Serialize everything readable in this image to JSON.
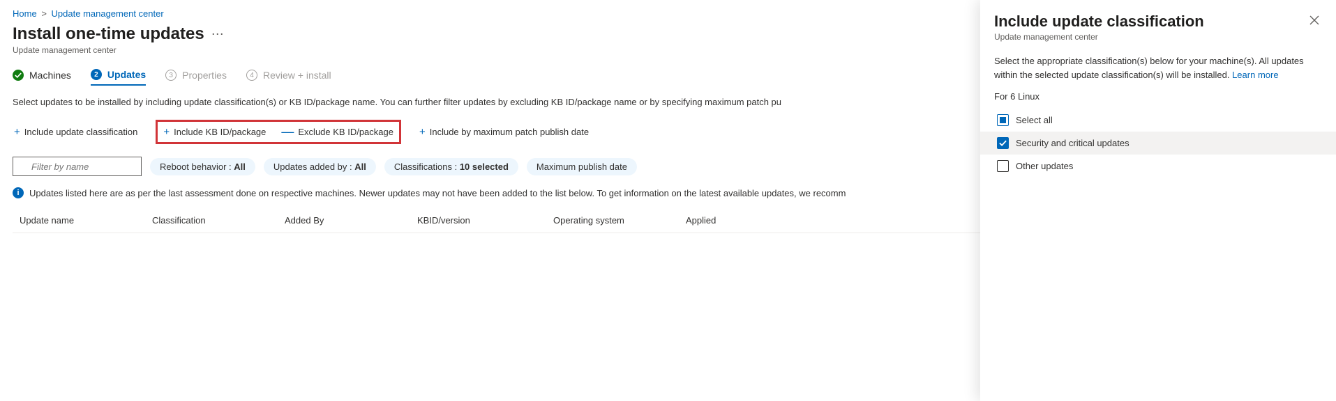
{
  "breadcrumb": {
    "home": "Home",
    "second": "Update management center"
  },
  "page": {
    "title": "Install one-time updates",
    "subtitle": "Update management center"
  },
  "tabs": {
    "t1": "Machines",
    "t2": "Updates",
    "t3": "Properties",
    "t4": "Review + install",
    "n3": "3",
    "n4": "4",
    "n2": "2"
  },
  "description": "Select updates to be installed by including update classification(s) or KB ID/package name. You can further filter updates by excluding KB ID/package name or by specifying maximum patch pu",
  "actions": {
    "a1": "Include update classification",
    "a2": "Include KB ID/package",
    "a3": "Exclude KB ID/package",
    "a4": "Include by maximum patch publish date"
  },
  "filter": {
    "placeholder": "Filter by name",
    "p1_label": "Reboot behavior :",
    "p1_val": "All",
    "p2_label": "Updates added by :",
    "p2_val": "All",
    "p3_label": "Classifications :",
    "p3_val": "10 selected",
    "p4_label": "Maximum publish date"
  },
  "info": "Updates listed here are as per the last assessment done on respective machines. Newer updates may not have been added to the list below. To get information on the latest available updates, we recomm",
  "columns": {
    "c1": "Update name",
    "c2": "Classification",
    "c3": "Added By",
    "c4": "KBID/version",
    "c5": "Operating system",
    "c6": "Applied"
  },
  "panel": {
    "title": "Include update classification",
    "subtitle": "Update management center",
    "desc": "Select the appropriate classification(s) below for your machine(s). All updates within the selected update classification(s) will be installed.",
    "learn": "Learn more",
    "for": "For 6 Linux",
    "opt_all": "Select all",
    "opt_sec": "Security and critical updates",
    "opt_other": "Other updates"
  }
}
